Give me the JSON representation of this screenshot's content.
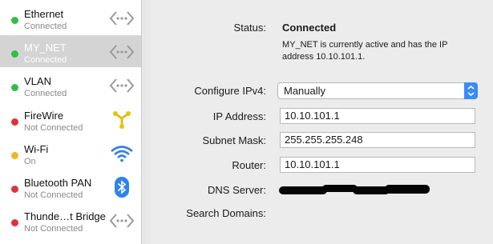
{
  "sidebar": {
    "services": [
      {
        "name": "Ethernet",
        "status": "Connected",
        "dot_color": "#2ec140",
        "icon": "ethernet-arrows-icon",
        "selected": false
      },
      {
        "name": "MY_NET",
        "status": "Connected",
        "dot_color": "#2ec140",
        "icon": "ethernet-arrows-icon",
        "selected": true
      },
      {
        "name": "VLAN",
        "status": "Connected",
        "dot_color": "#2ec140",
        "icon": "ethernet-arrows-icon",
        "selected": false
      },
      {
        "name": "FireWire",
        "status": "Not Connected",
        "dot_color": "#e0313c",
        "icon": "firewire-icon",
        "selected": false
      },
      {
        "name": "Wi-Fi",
        "status": "On",
        "dot_color": "#f4b427",
        "icon": "wifi-icon",
        "selected": false
      },
      {
        "name": "Bluetooth PAN",
        "status": "Not Connected",
        "dot_color": "#e0313c",
        "icon": "bluetooth-icon",
        "selected": false
      },
      {
        "name": "Thunde…t Bridge",
        "status": "Not Connected",
        "dot_color": "#e0313c",
        "icon": "thunderbolt-bridge-icon",
        "selected": false
      }
    ]
  },
  "detail": {
    "status_label": "Status:",
    "status_value": "Connected",
    "status_description": "MY_NET is currently active and has the IP address 10.10.101.1.",
    "configure_ipv4_label": "Configure IPv4:",
    "configure_ipv4_value": "Manually",
    "ip_address_label": "IP Address:",
    "ip_address_value": "10.10.101.1",
    "subnet_mask_label": "Subnet Mask:",
    "subnet_mask_value": "255.255.255.248",
    "router_label": "Router:",
    "router_value": "10.10.101.1",
    "dns_server_label": "DNS Server:",
    "search_domains_label": "Search Domains:"
  },
  "colors": {
    "green": "#2ec140",
    "red": "#e0313c",
    "amber": "#f4b427",
    "accent_blue": "#3b8bf6",
    "selection": "#d4d4d4"
  }
}
